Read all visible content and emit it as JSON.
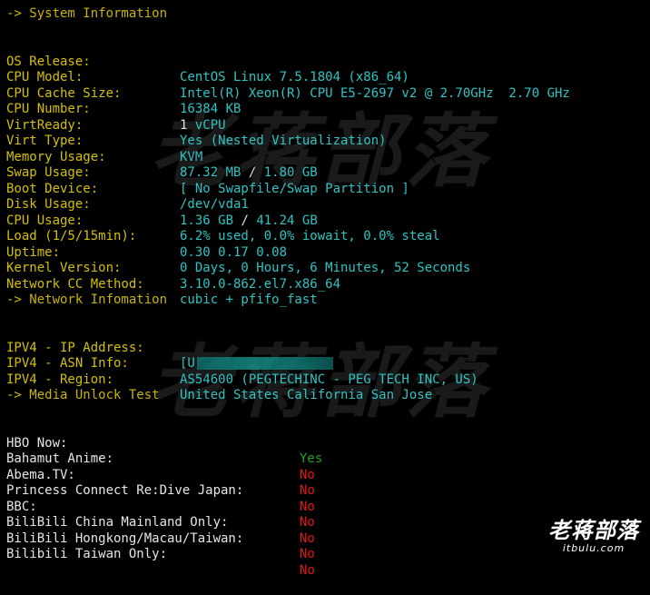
{
  "watermark": {
    "text": "老蒋部落"
  },
  "corner_logo": {
    "cn": "老蒋部落",
    "en": "itbulu.com"
  },
  "system": {
    "header": "-> System Information",
    "rows": [
      {
        "label": "OS Release:",
        "value": "CentOS Linux 7.5.1804 (x86_64)"
      },
      {
        "label": "CPU Model:",
        "value": "Intel(R) Xeon(R) CPU E5-2697 v2 @ 2.70GHz  2.70 GHz"
      },
      {
        "label": "CPU Cache Size:",
        "value": "16384 KB"
      },
      {
        "label": "CPU Number:",
        "value_num": "1",
        "value": " vCPU"
      },
      {
        "label": "VirtReady:",
        "value": "Yes (Nested Virtualization)"
      },
      {
        "label": "Virt Type:",
        "value": "KVM"
      },
      {
        "label": "Memory Usage:",
        "value_a": "87.32 MB",
        "value_sep": " / ",
        "value_b": "1.80 GB"
      },
      {
        "label": "Swap Usage:",
        "value": "[ No Swapfile/Swap Partition ]"
      },
      {
        "label": "Boot Device:",
        "value": "/dev/vda1"
      },
      {
        "label": "Disk Usage:",
        "value_a": "1.36 GB",
        "value_sep": " / ",
        "value_b": "41.24 GB"
      },
      {
        "label": "CPU Usage:",
        "value": "6.2% used, 0.0% iowait, 0.0% steal"
      },
      {
        "label": "Load (1/5/15min):",
        "value": "0.30 0.17 0.08"
      },
      {
        "label": "Uptime:",
        "value": "0 Days, 0 Hours, 6 Minutes, 52 Seconds"
      },
      {
        "label": "Kernel Version:",
        "value": "3.10.0-862.el7.x86_64"
      },
      {
        "label": "Network CC Method:",
        "value": "cubic + pfifo_fast"
      }
    ]
  },
  "network": {
    "header": "-> Network Infomation",
    "rows": [
      {
        "label": "IPV4 - IP Address:",
        "value": "[U"
      },
      {
        "label": "IPV4 - ASN Info:",
        "value": "AS54600 (PEGTECHINC - PEG TECH INC, US)"
      },
      {
        "label": "IPV4 - Region:",
        "value": "United States California San Jose"
      }
    ]
  },
  "media": {
    "header": "-> Media Unlock Test",
    "rows": [
      {
        "label": "HBO Now:",
        "status": "Yes"
      },
      {
        "label": "Bahamut Anime:",
        "status": "No"
      },
      {
        "label": "Abema.TV:",
        "status": "No"
      },
      {
        "label": "Princess Connect Re:Dive Japan:",
        "status": "No"
      },
      {
        "label": "BBC:",
        "status": "No"
      },
      {
        "label": "BiliBili China Mainland Only:",
        "status": "No"
      },
      {
        "label": "BiliBili Hongkong/Macau/Taiwan:",
        "status": "No"
      },
      {
        "label": "Bilibili Taiwan Only:",
        "status": "No"
      }
    ]
  },
  "colors": {
    "background": "#000000",
    "label": "#d4c000",
    "value": "#2ec4c4",
    "yes": "#2aa02a",
    "no": "#e01818"
  }
}
